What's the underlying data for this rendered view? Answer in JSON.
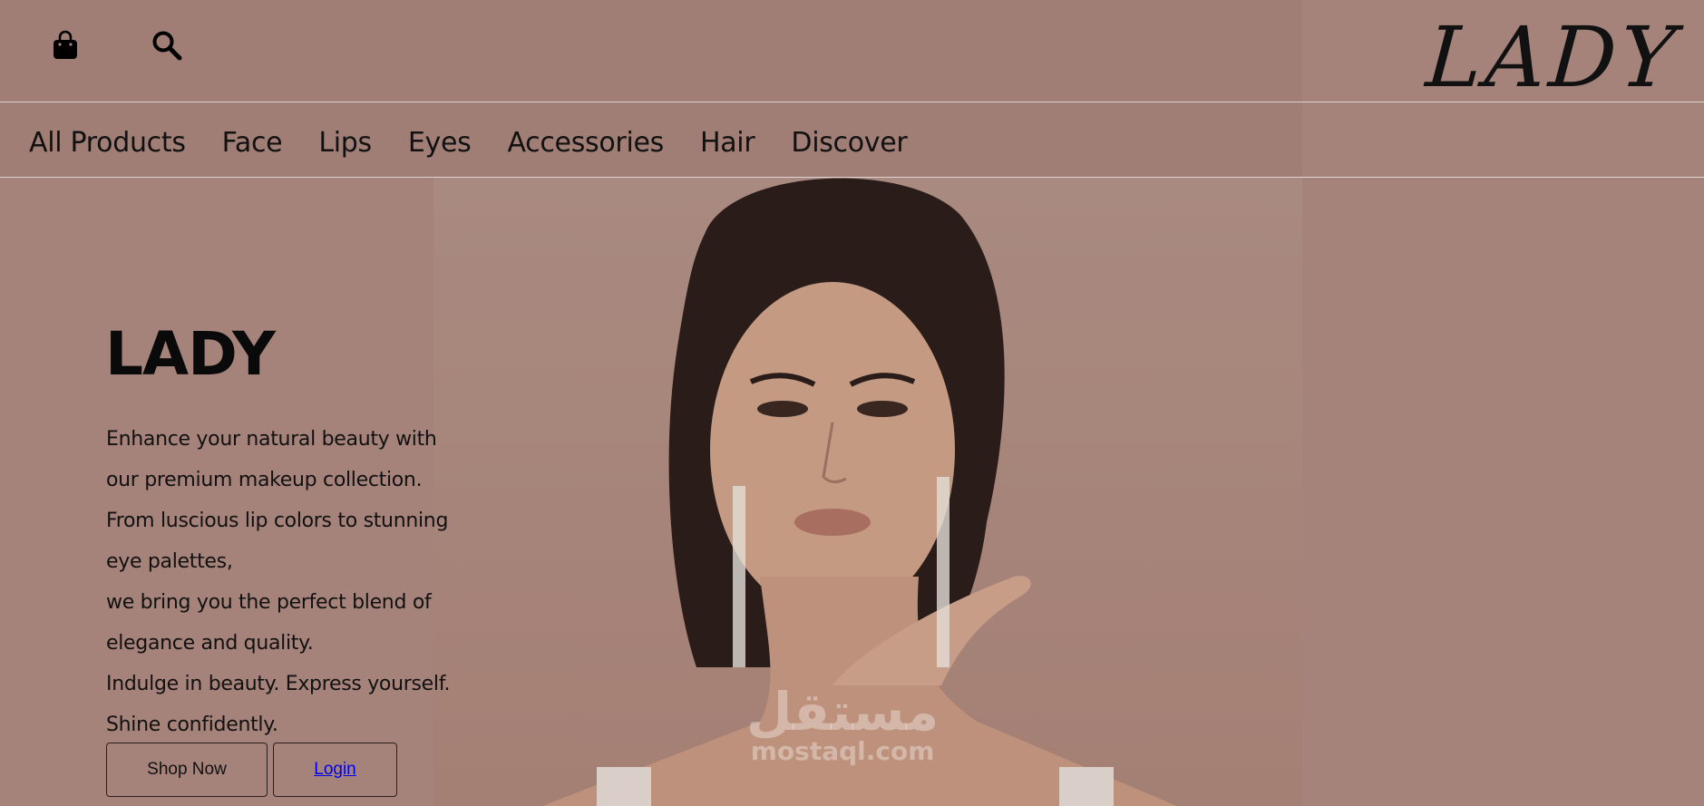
{
  "header": {
    "logo": "LADY",
    "icons": [
      "shopping-bag-icon",
      "search-icon"
    ]
  },
  "nav": {
    "items": [
      "All Products",
      "Face",
      "Lips",
      "Eyes",
      "Accessories",
      "Hair",
      "Discover"
    ]
  },
  "hero": {
    "title": "LADY",
    "lines": [
      "Enhance your natural beauty with",
      "our premium makeup collection.",
      "From luscious lip colors to stunning",
      "eye palettes,",
      "we bring you the perfect blend of",
      "elegance and quality.",
      "Indulge in beauty. Express yourself.",
      "Shine confidently."
    ],
    "shop_button": "Shop Now",
    "login_link": "Login",
    "watermark_ar": "مستقل",
    "watermark_en": "mostaql.com"
  },
  "colors": {
    "background": "#a6837a",
    "text": "#111111",
    "link": "#0000ee"
  }
}
